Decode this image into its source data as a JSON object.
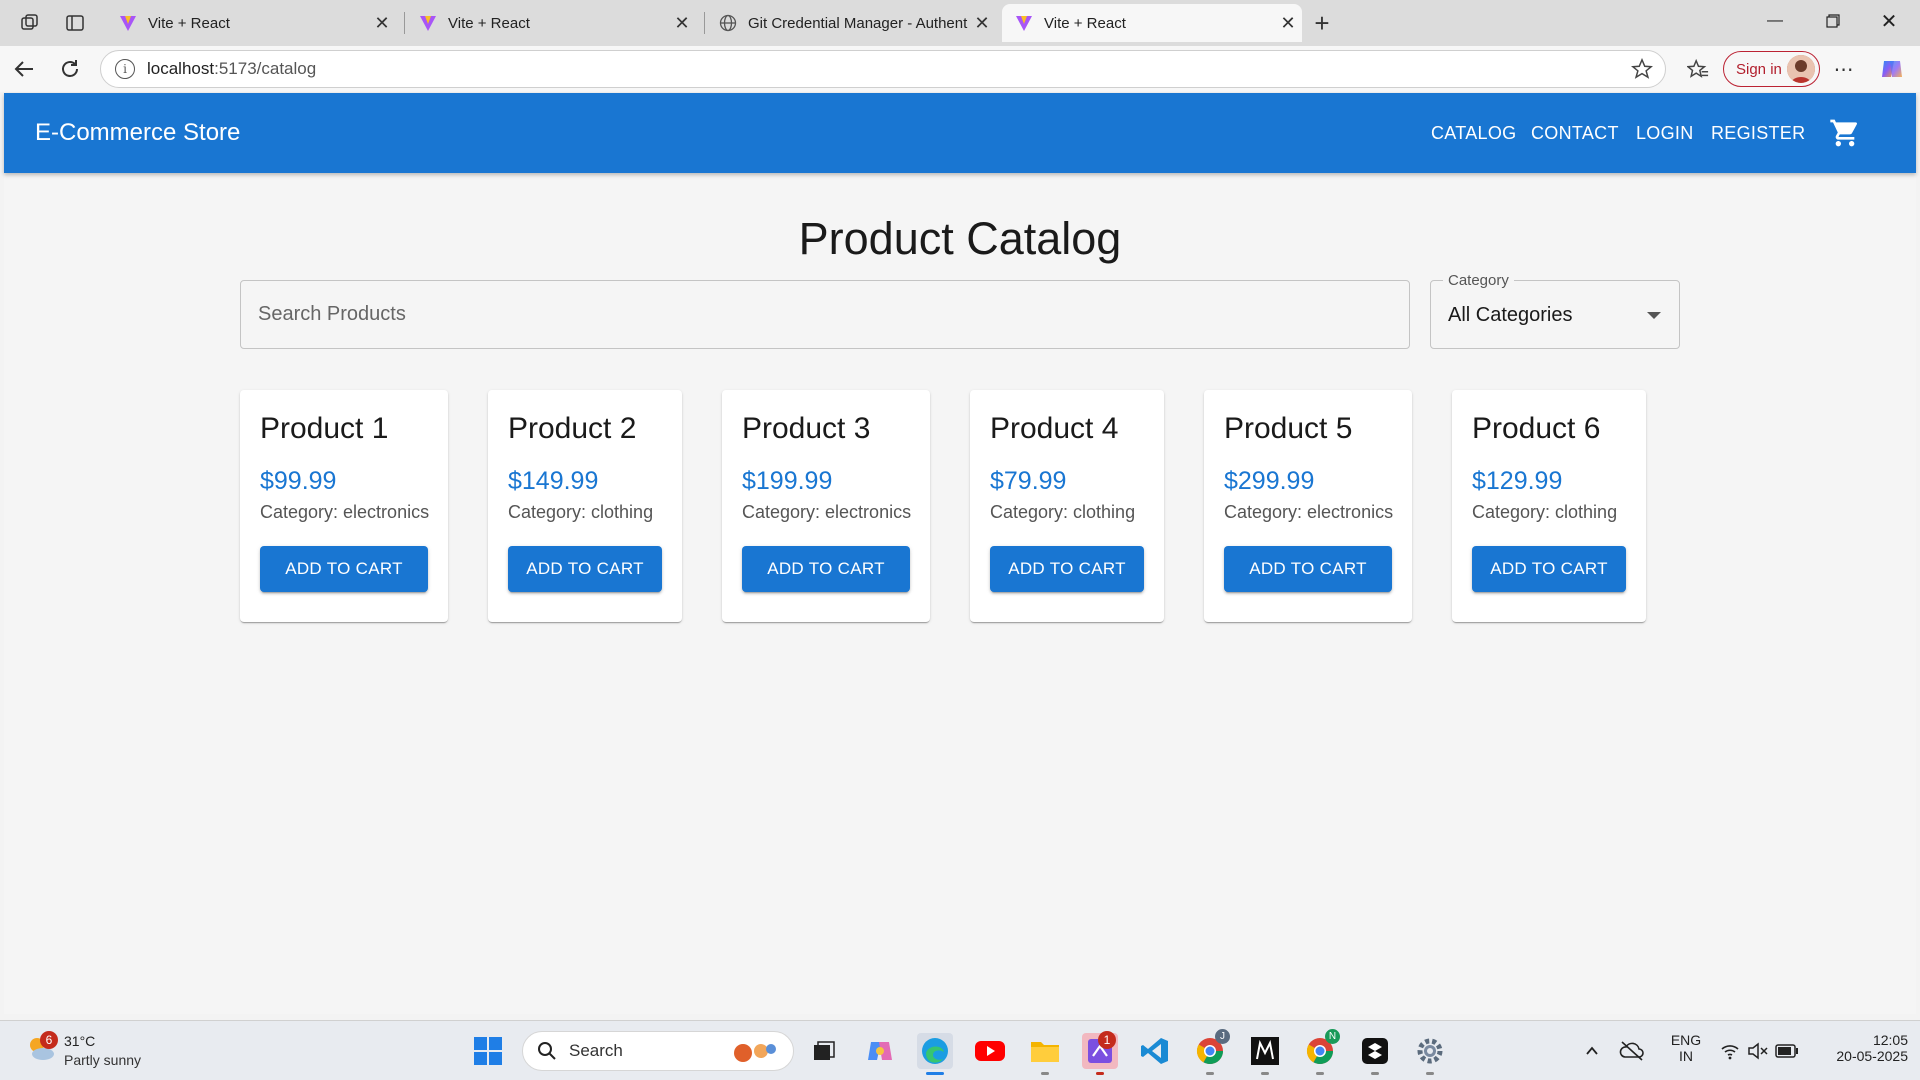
{
  "browser": {
    "tabs": [
      {
        "title": "Vite + React",
        "active": false
      },
      {
        "title": "Vite + React",
        "active": false
      },
      {
        "title": "Git Credential Manager - Authent",
        "active": false
      },
      {
        "title": "Vite + React",
        "active": true
      }
    ],
    "url_host": "localhost",
    "url_rest": ":5173/catalog",
    "signin_label": "Sign in"
  },
  "app": {
    "brand": "E-Commerce Store",
    "nav": [
      "CATALOG",
      "CONTACT",
      "LOGIN",
      "REGISTER"
    ],
    "page_title": "Product Catalog",
    "search_placeholder": "Search Products",
    "category_label": "Category",
    "category_value": "All Categories",
    "products": [
      {
        "name": "Product 1",
        "price": "$99.99",
        "category": "Category: electronics",
        "button": "ADD TO CART"
      },
      {
        "name": "Product 2",
        "price": "$149.99",
        "category": "Category: clothing",
        "button": "ADD TO CART"
      },
      {
        "name": "Product 3",
        "price": "$199.99",
        "category": "Category: electronics",
        "button": "ADD TO CART"
      },
      {
        "name": "Product 4",
        "price": "$79.99",
        "category": "Category: clothing",
        "button": "ADD TO CART"
      },
      {
        "name": "Product 5",
        "price": "$299.99",
        "category": "Category: electronics",
        "button": "ADD TO CART"
      },
      {
        "name": "Product 6",
        "price": "$129.99",
        "category": "Category: clothing",
        "button": "ADD TO CART"
      }
    ]
  },
  "taskbar": {
    "weather_temp": "31°C",
    "weather_cond": "Partly sunny",
    "weather_badge": "6",
    "search_label": "Search",
    "lang_top": "ENG",
    "lang_bottom": "IN",
    "time": "12:05",
    "date": "20-05-2025",
    "app_badge": "1"
  },
  "colors": {
    "primary": "#1976d2",
    "background": "#f5f5f5"
  }
}
